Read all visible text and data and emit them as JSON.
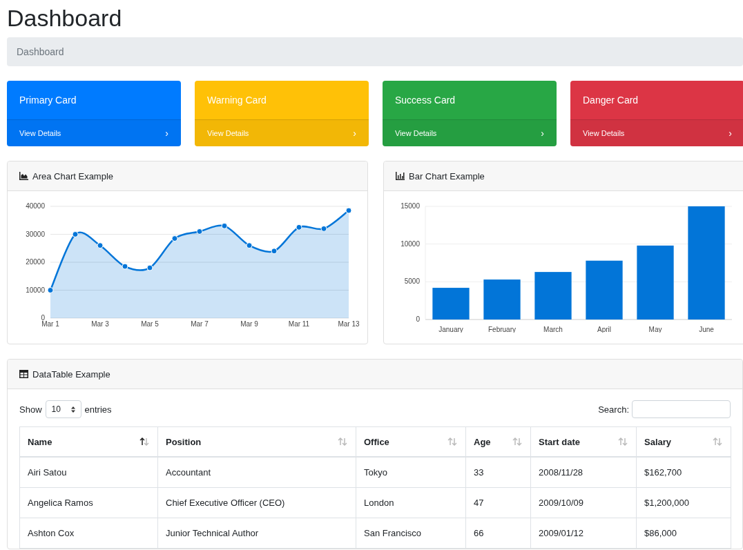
{
  "page_title": "Dashboard",
  "breadcrumb": [
    "Dashboard"
  ],
  "cards": [
    {
      "title": "Primary Card",
      "link": "View Details",
      "chevron": "›",
      "color": "#007bff"
    },
    {
      "title": "Warning Card",
      "link": "View Details",
      "chevron": "›",
      "color": "#ffc107"
    },
    {
      "title": "Success Card",
      "link": "View Details",
      "chevron": "›",
      "color": "#28a745"
    },
    {
      "title": "Danger Card",
      "link": "View Details",
      "chevron": "›",
      "color": "#dc3545"
    }
  ],
  "area_chart": {
    "header": "Area Chart Example",
    "chart_data": {
      "type": "area",
      "categories": [
        "Mar 1",
        null,
        "Mar 3",
        null,
        "Mar 5",
        null,
        "Mar 7",
        null,
        "Mar 9",
        null,
        "Mar 11",
        null,
        "Mar 13"
      ],
      "series": [
        {
          "color": "#0275d8",
          "values": [
            10000,
            30000,
            26000,
            18500,
            18000,
            28500,
            31000,
            33000,
            26000,
            24000,
            32500,
            32000,
            38500
          ]
        }
      ],
      "ylim": [
        0,
        40000
      ],
      "yticks": [
        0,
        10000,
        20000,
        30000,
        40000
      ],
      "grid": true
    }
  },
  "bar_chart": {
    "header": "Bar Chart Example",
    "chart_data": {
      "type": "bar",
      "categories": [
        "January",
        "February",
        "March",
        "April",
        "May",
        "June"
      ],
      "series": [
        {
          "color": "#0275d8",
          "values": [
            4200,
            5300,
            6300,
            7800,
            9800,
            15000
          ]
        }
      ],
      "ylim": [
        0,
        15000
      ],
      "yticks": [
        0,
        5000,
        10000,
        15000
      ],
      "grid": true
    }
  },
  "table_card": {
    "header": "DataTable Example",
    "show_label": "Show",
    "page_size": "10",
    "entries_label": "entries",
    "search_label": "Search:",
    "columns": [
      {
        "label": "Name",
        "sorted_ascending": true
      },
      {
        "label": "Position",
        "sorted_ascending": false
      },
      {
        "label": "Office",
        "sorted_ascending": false
      },
      {
        "label": "Age",
        "sorted_ascending": false
      },
      {
        "label": "Start date",
        "sorted_ascending": false
      },
      {
        "label": "Salary",
        "sorted_ascending": false
      }
    ],
    "rows": [
      [
        "Airi Satou",
        "Accountant",
        "Tokyo",
        "33",
        "2008/11/28",
        "$162,700"
      ],
      [
        "Angelica Ramos",
        "Chief Executive Officer (CEO)",
        "London",
        "47",
        "2009/10/09",
        "$1,200,000"
      ],
      [
        "Ashton Cox",
        "Junior Technical Author",
        "San Francisco",
        "66",
        "2009/01/12",
        "$86,000"
      ]
    ]
  }
}
